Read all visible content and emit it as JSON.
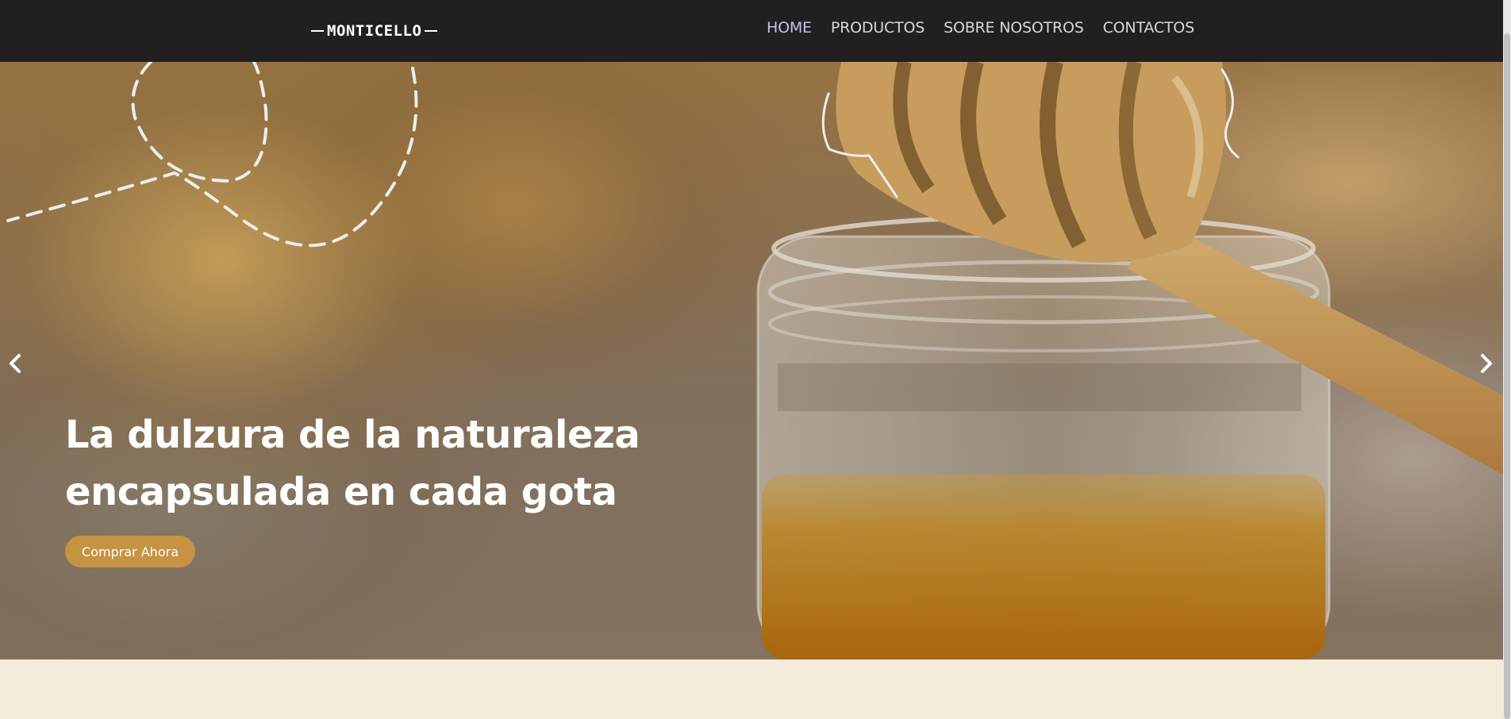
{
  "brand": {
    "logo_text": "MONTICELLO"
  },
  "nav": {
    "items": [
      {
        "label": "HOME"
      },
      {
        "label": "PRODUCTOS"
      },
      {
        "label": "SOBRE NOSOTROS"
      },
      {
        "label": "CONTACTOS"
      }
    ]
  },
  "hero": {
    "headline_line1": "La dulzura de la naturaleza",
    "headline_line2": "encapsulada en cada gota",
    "cta_label": "Comprar Ahora",
    "prev_icon": "chevron-left-icon",
    "next_icon": "chevron-right-icon"
  },
  "colors": {
    "navbar_bg": "#221f20",
    "accent": "#c69343",
    "page_bg": "#f4ebdb",
    "nav_active": "#c7c2ee"
  }
}
